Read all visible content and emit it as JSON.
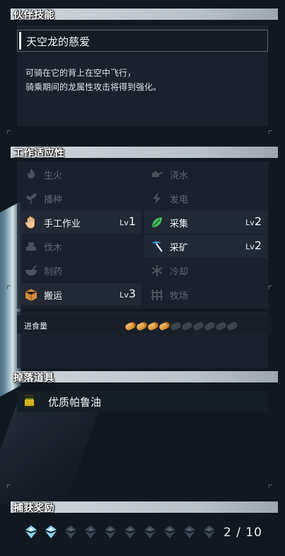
{
  "partner_skill": {
    "header": "伙伴技能",
    "name": "天空龙的慈爱",
    "description_line1": "可骑在它的背上在空中飞行，",
    "description_line2": "骑乘期间的龙属性攻击将得到强化。"
  },
  "work_suitability": {
    "header": "工作适应性",
    "items": [
      {
        "label": "生火",
        "active": false,
        "icon": "fire-icon"
      },
      {
        "label": "浇水",
        "active": false,
        "icon": "watering-icon"
      },
      {
        "label": "播种",
        "active": false,
        "icon": "sprout-icon"
      },
      {
        "label": "发电",
        "active": false,
        "icon": "lightning-icon"
      },
      {
        "label": "手工作业",
        "active": true,
        "level_prefix": "Lv",
        "level": "1",
        "icon": "hand-icon"
      },
      {
        "label": "采集",
        "active": true,
        "level_prefix": "Lv",
        "level": "2",
        "icon": "leaf-icon"
      },
      {
        "label": "伐木",
        "active": false,
        "icon": "lumber-icon"
      },
      {
        "label": "采矿",
        "active": true,
        "level_prefix": "Lv",
        "level": "2",
        "icon": "pickaxe-icon"
      },
      {
        "label": "制药",
        "active": false,
        "icon": "mortar-icon"
      },
      {
        "label": "冷却",
        "active": false,
        "icon": "snowflake-icon"
      },
      {
        "label": "搬运",
        "active": true,
        "level_prefix": "Lv",
        "level": "3",
        "icon": "box-icon"
      },
      {
        "label": "牧场",
        "active": false,
        "icon": "ranch-icon"
      }
    ]
  },
  "food": {
    "label": "进食量",
    "filled": 4,
    "total": 10
  },
  "drops": {
    "header": "掉落道具",
    "items": [
      {
        "label": "优质帕鲁油",
        "icon": "oil-jar-icon"
      }
    ]
  },
  "capture": {
    "header": "捕获奖励",
    "current": 2,
    "max": 10,
    "count_text": "2 / 10"
  },
  "colors": {
    "accent_gem": "#8fd4f0",
    "bread": "#e8a64a",
    "leaf": "#3fbf5a",
    "pickaxe": "#3aa0e0",
    "box": "#d08a3a"
  }
}
